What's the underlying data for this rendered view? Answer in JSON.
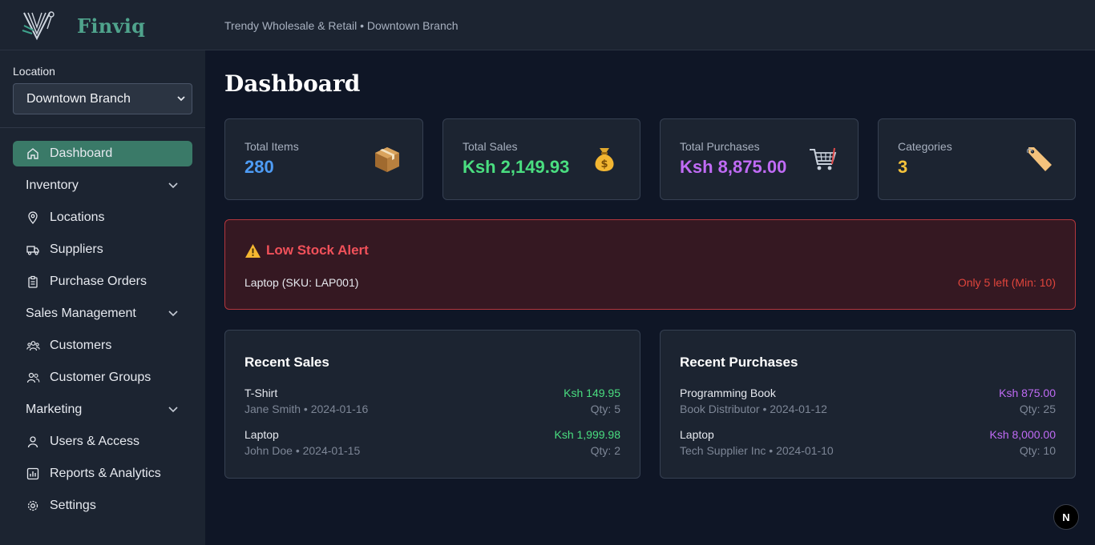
{
  "app": {
    "brand": "Finviq",
    "breadcrumb": "Trendy Wholesale & Retail • Downtown Branch"
  },
  "sidebar": {
    "location_label": "Location",
    "location_value": "Downtown Branch",
    "items": [
      {
        "label": "Dashboard",
        "icon": "home-icon",
        "active": true
      },
      {
        "label": "Inventory",
        "section": true
      },
      {
        "label": "Locations",
        "icon": "map-pin-icon"
      },
      {
        "label": "Suppliers",
        "icon": "truck-icon"
      },
      {
        "label": "Purchase Orders",
        "icon": "clipboard-icon"
      },
      {
        "label": "Sales Management",
        "section": true
      },
      {
        "label": "Customers",
        "icon": "users-icon"
      },
      {
        "label": "Customer Groups",
        "icon": "user-group-icon"
      },
      {
        "label": "Marketing",
        "section": true
      },
      {
        "label": "Users & Access",
        "icon": "user-icon"
      },
      {
        "label": "Reports & Analytics",
        "icon": "chart-icon"
      },
      {
        "label": "Settings",
        "icon": "gear-icon"
      }
    ]
  },
  "main": {
    "title": "Dashboard",
    "stats": [
      {
        "label": "Total Items",
        "value": "280",
        "icon": "package-icon",
        "color": "#4e9cf5"
      },
      {
        "label": "Total Sales",
        "value": "Ksh 2,149.93",
        "icon": "money-bag-icon",
        "color": "#4ade80"
      },
      {
        "label": "Total Purchases",
        "value": "Ksh 8,875.00",
        "icon": "shopping-cart-icon",
        "color": "#c06bf5"
      },
      {
        "label": "Categories",
        "value": "3",
        "icon": "tag-icon",
        "color": "#f5c33b"
      }
    ],
    "alert": {
      "title": "Low Stock Alert",
      "item": "Laptop (SKU: LAP001)",
      "note": "Only 5 left (Min: 10)"
    },
    "recent_sales": {
      "title": "Recent Sales",
      "rows": [
        {
          "name": "T-Shirt",
          "sub": "Jane Smith • 2024-01-16",
          "amount": "Ksh 149.95",
          "qty": "Qty: 5"
        },
        {
          "name": "Laptop",
          "sub": "John Doe • 2024-01-15",
          "amount": "Ksh 1,999.98",
          "qty": "Qty: 2"
        }
      ]
    },
    "recent_purchases": {
      "title": "Recent Purchases",
      "rows": [
        {
          "name": "Programming Book",
          "sub": "Book Distributor • 2024-01-12",
          "amount": "Ksh 875.00",
          "qty": "Qty: 25"
        },
        {
          "name": "Laptop",
          "sub": "Tech Supplier Inc • 2024-01-10",
          "amount": "Ksh 8,000.00",
          "qty": "Qty: 10"
        }
      ]
    }
  },
  "floating_badge": "N",
  "colors": {
    "accent": "#3a7a68",
    "sales_green": "#4ade80",
    "purchase_purple": "#c06bf5",
    "alert_red": "#f1515a"
  }
}
